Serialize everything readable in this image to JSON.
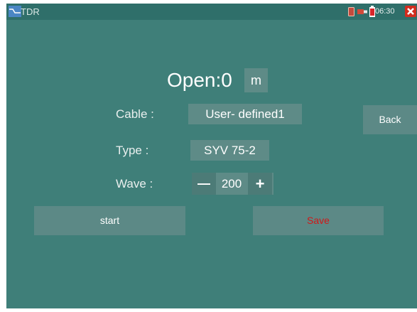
{
  "statusbar": {
    "app_title": "TDR",
    "time": "06:30"
  },
  "main": {
    "status_label": "Open:",
    "length_value": "0",
    "length_unit": "m",
    "cable_label": "Cable  :",
    "cable_value": "User- defined1",
    "type_label": "Type   :",
    "type_value": "SYV 75-2",
    "wave_label": "Wave   :",
    "wave_value": "200",
    "wave_minus": "—",
    "wave_plus": "+"
  },
  "buttons": {
    "back": "Back",
    "start": "start",
    "save": "Save"
  },
  "colors": {
    "background": "#3f7f79",
    "button": "#5c8986",
    "save_text": "#d01818"
  },
  "icons": [
    "tdr-app-icon",
    "sd-card-icon",
    "usb-icon",
    "battery-icon",
    "close-icon"
  ]
}
